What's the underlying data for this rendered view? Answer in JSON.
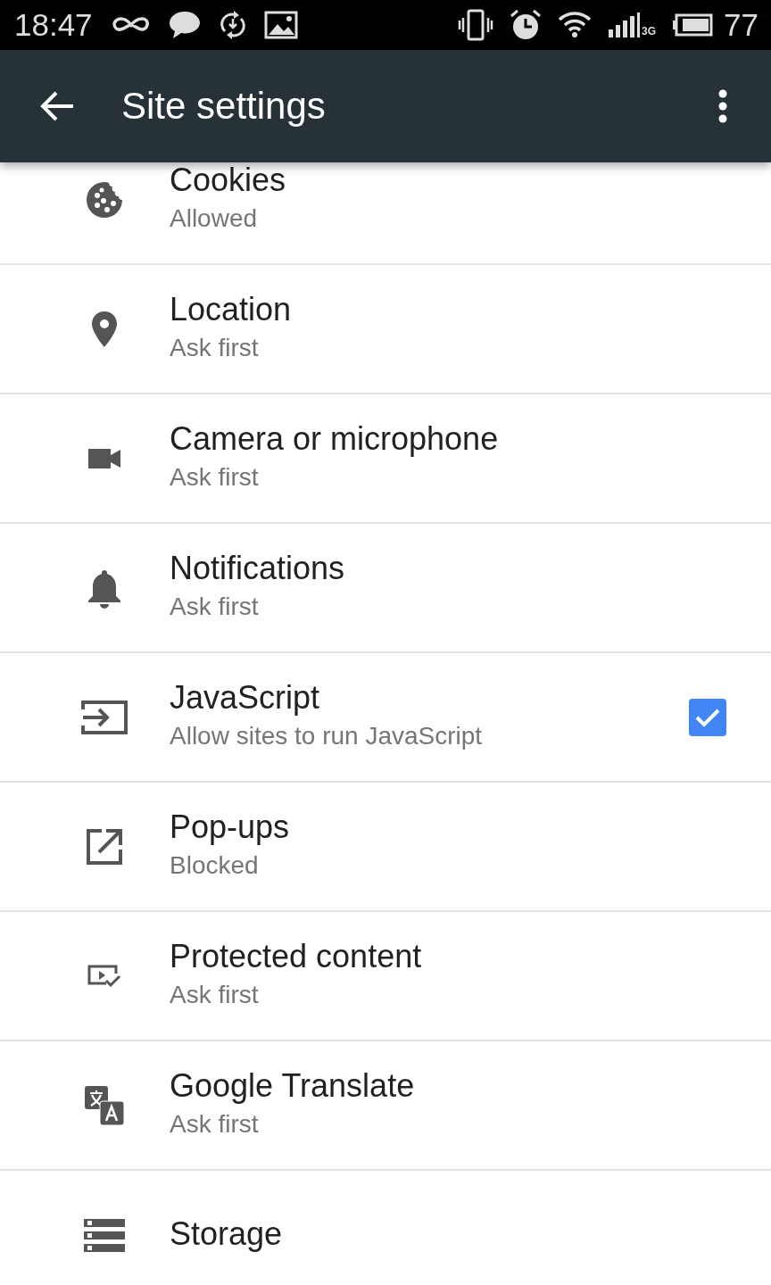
{
  "status_bar": {
    "time": "18:47",
    "network_type": "3G",
    "battery": "77"
  },
  "toolbar": {
    "title": "Site settings"
  },
  "settings": [
    {
      "title": "Cookies",
      "subtitle": "Allowed",
      "kind": "plain"
    },
    {
      "title": "Location",
      "subtitle": "Ask first",
      "kind": "plain"
    },
    {
      "title": "Camera or microphone",
      "subtitle": "Ask first",
      "kind": "plain"
    },
    {
      "title": "Notifications",
      "subtitle": "Ask first",
      "kind": "plain"
    },
    {
      "title": "JavaScript",
      "subtitle": "Allow sites to run JavaScript",
      "kind": "checkbox",
      "checked": true
    },
    {
      "title": "Pop-ups",
      "subtitle": "Blocked",
      "kind": "plain"
    },
    {
      "title": "Protected content",
      "subtitle": "Ask first",
      "kind": "plain"
    },
    {
      "title": "Google Translate",
      "subtitle": "Ask first",
      "kind": "plain"
    },
    {
      "title": "Storage",
      "kind": "plain"
    }
  ]
}
